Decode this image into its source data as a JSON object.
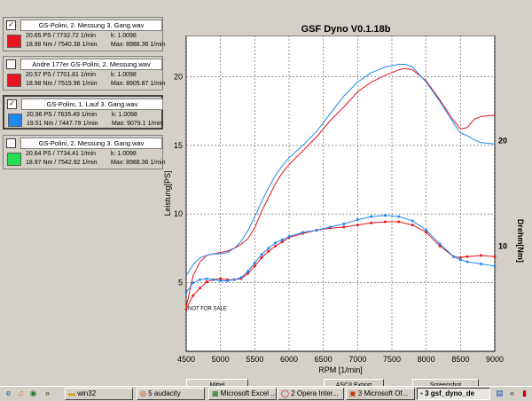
{
  "cards": [
    {
      "name": "GS-Polini, 2. Messung 3. Gang.wav",
      "checked": "✓",
      "power": "20.65 PS / 7732.72 1/min",
      "torque": "18.98 Nm / 7540.38 1/min",
      "k": "k: 1.0098",
      "max": "Max: 8988.36 1/min",
      "color": "#e8141e"
    },
    {
      "name": "Andre 177er GS-Polini, 2. Messung.wav",
      "checked": "",
      "power": "20.57 PS / 7701.81 1/min",
      "torque": "18.98 Nm / 7515.96 1/min",
      "k": "k: 1.0098",
      "max": "Max: 8905.87 1/min",
      "color": "#e8141e"
    },
    {
      "name": "GS-Polini, 1. Lauf 3. Gang.wav",
      "checked": "✓",
      "power": "20.96 PS / 7635.49 1/min",
      "torque": "19.51 Nm / 7447.79 1/min",
      "k": "k: 1.0098",
      "max": "Max: 9079.1 1/min",
      "color": "#1e88f0"
    },
    {
      "name": "GS-Polini, 2. Messung 3. Gang.wav",
      "checked": "",
      "power": "20.64 PS / 7734.41 1/min",
      "torque": "18.97 Nm / 7542.92 1/min",
      "k": "k: 1.0098",
      "max": "Max: 8988.36 1/min",
      "color": "#22e050"
    }
  ],
  "chart_title": "GSF Dyno V0.1.18b",
  "buttons": {
    "mittel": "Mittel",
    "ascii": "ASCII Export",
    "screenshot": "Screenshot"
  },
  "taskbar": {
    "quick_icons": [
      "ie-icon",
      "media-icon",
      "explorer-icon"
    ],
    "chevron": "»",
    "tasks": [
      "win32",
      "5 audacity",
      "Microsoft Excel ...",
      "2 Opera Inter...",
      "3 Microsoft Of...",
      "3 gsf_dyno_de"
    ],
    "active_task_index": 5,
    "tray_chevron": "«"
  },
  "chart_data": {
    "type": "line",
    "title": "GSF Dyno V0.1.18b",
    "xlabel": "RPM [1/min]",
    "ylabel": "Leistung[PS]",
    "y2label": "Drehm[Nm]",
    "xlim": [
      4500,
      9000
    ],
    "ylim": [
      0,
      23
    ],
    "y2lim": [
      0,
      30
    ],
    "xticks": [
      4500,
      5000,
      5500,
      6000,
      6500,
      7000,
      7500,
      8000,
      8500,
      9000
    ],
    "yticks": [
      5,
      10,
      15,
      20
    ],
    "y2ticks": [
      10,
      20
    ],
    "grid": true,
    "watermark": "NOT FOR SALE",
    "series": [
      {
        "name": "GS-Polini, 2. Messung 3. Gang.wav",
        "kind": "power",
        "color": "#e8141e",
        "x": [
          4500,
          4600,
          4700,
          4800,
          4900,
          5000,
          5100,
          5200,
          5300,
          5400,
          5500,
          5600,
          5700,
          5800,
          5900,
          6000,
          6200,
          6400,
          6600,
          6800,
          7000,
          7200,
          7400,
          7600,
          7700,
          7800,
          8000,
          8200,
          8400,
          8500,
          8600,
          8700,
          8800,
          9000
        ],
        "y": [
          3.2,
          5.5,
          6.5,
          7.0,
          7.1,
          7.2,
          7.3,
          7.5,
          7.8,
          8.2,
          9.0,
          10.2,
          11.2,
          12.2,
          13.0,
          13.6,
          14.6,
          15.6,
          16.8,
          17.8,
          18.9,
          19.6,
          20.1,
          20.5,
          20.6,
          20.5,
          19.7,
          18.3,
          16.8,
          16.2,
          16.3,
          16.9,
          17.1,
          17.2
        ]
      },
      {
        "name": "GS-Polini, 1. Lauf 3. Gang.wav",
        "kind": "power",
        "color": "#1e88f0",
        "x": [
          4500,
          4600,
          4700,
          4800,
          4900,
          5000,
          5100,
          5200,
          5300,
          5400,
          5500,
          5600,
          5700,
          5800,
          5900,
          6000,
          6200,
          6400,
          6600,
          6800,
          7000,
          7200,
          7400,
          7600,
          7700,
          7800,
          8000,
          8200,
          8400,
          8500,
          8600,
          8700,
          8800,
          9000
        ],
        "y": [
          5.5,
          6.3,
          6.8,
          7.0,
          7.1,
          7.1,
          7.2,
          7.5,
          8.0,
          8.8,
          9.8,
          10.9,
          11.9,
          12.8,
          13.5,
          14.1,
          15.0,
          16.0,
          17.3,
          18.6,
          19.6,
          20.3,
          20.7,
          20.9,
          20.9,
          20.7,
          19.6,
          18.2,
          16.6,
          15.9,
          15.7,
          15.4,
          15.2,
          15.1
        ]
      },
      {
        "name": "GS-Polini, 2. Messung 3. Gang.wav",
        "kind": "torque",
        "color": "#e8141e",
        "x": [
          4500,
          4600,
          4700,
          4800,
          4900,
          5000,
          5100,
          5200,
          5300,
          5400,
          5500,
          5600,
          5700,
          5800,
          5900,
          6000,
          6200,
          6400,
          6600,
          6800,
          7000,
          7200,
          7400,
          7600,
          7800,
          8000,
          8200,
          8400,
          8500,
          8600,
          8800,
          9000
        ],
        "y": [
          4.0,
          5.3,
          6.0,
          6.6,
          6.8,
          6.9,
          6.8,
          6.8,
          6.9,
          7.4,
          8.1,
          8.9,
          9.5,
          10.0,
          10.4,
          10.8,
          11.2,
          11.5,
          11.7,
          11.8,
          12.0,
          12.2,
          12.3,
          12.3,
          12.0,
          11.3,
          10.0,
          9.0,
          8.9,
          9.0,
          9.1,
          9.0
        ]
      },
      {
        "name": "GS-Polini, 1. Lauf 3. Gang.wav",
        "kind": "torque",
        "color": "#1e88f0",
        "x": [
          4500,
          4600,
          4700,
          4800,
          4900,
          5000,
          5100,
          5200,
          5300,
          5400,
          5500,
          5600,
          5700,
          5800,
          5900,
          6000,
          6200,
          6400,
          6600,
          6800,
          7000,
          7200,
          7400,
          7600,
          7800,
          8000,
          8200,
          8400,
          8500,
          8600,
          8800,
          9000
        ],
        "y": [
          5.6,
          6.5,
          6.8,
          6.9,
          6.8,
          6.7,
          6.7,
          6.8,
          7.0,
          7.6,
          8.4,
          9.2,
          9.8,
          10.3,
          10.6,
          10.9,
          11.3,
          11.5,
          11.8,
          12.1,
          12.5,
          12.8,
          12.9,
          12.8,
          12.4,
          11.5,
          10.2,
          9.0,
          8.7,
          8.5,
          8.3,
          8.1
        ]
      }
    ]
  }
}
